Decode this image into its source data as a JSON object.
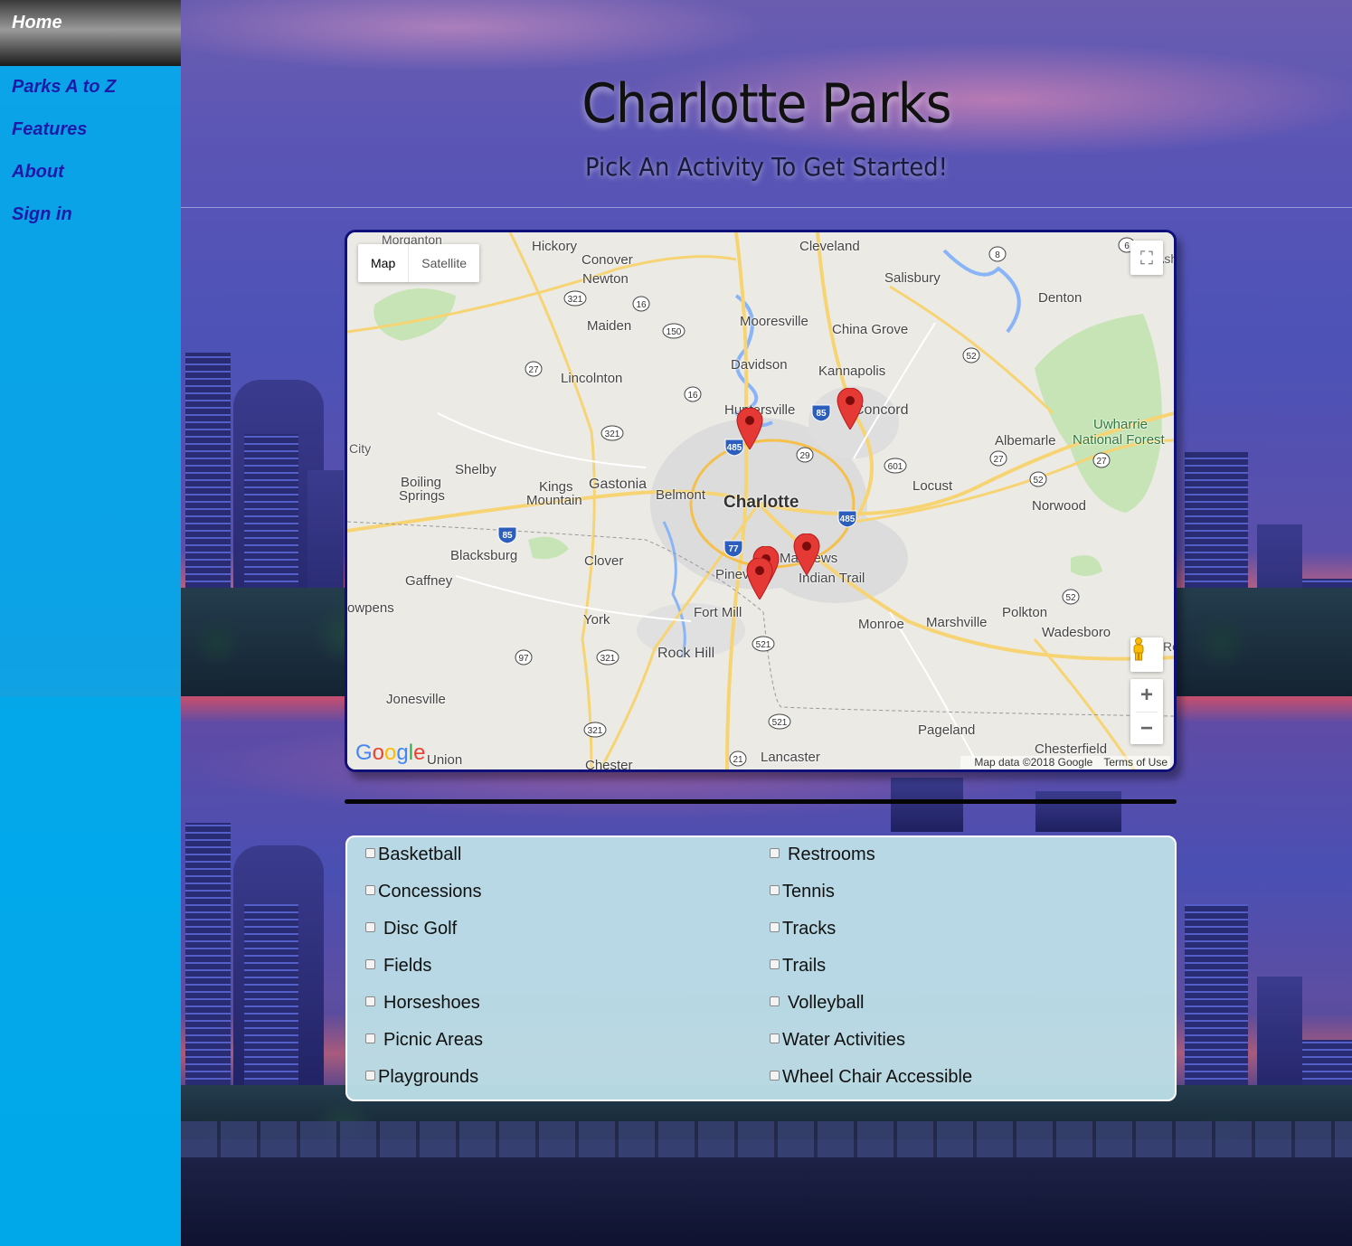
{
  "sidebar": {
    "items": [
      {
        "label": "Home"
      },
      {
        "label": "Parks A to Z"
      },
      {
        "label": "Features"
      },
      {
        "label": "About"
      },
      {
        "label": "Sign in"
      }
    ]
  },
  "header": {
    "title": "Charlotte Parks",
    "subtitle": "Pick An Activity To Get Started!"
  },
  "map": {
    "type_buttons": [
      "Map",
      "Satellite"
    ],
    "selected_type": "Map",
    "attribution": "Map data ©2018 Google",
    "terms": "Terms of Use",
    "logo": "Google",
    "labels": {
      "charlotte": "Charlotte",
      "gastonia": "Gastonia",
      "rock_hill": "Rock Hill",
      "concord": "Concord",
      "kannapolis": "Kannapolis",
      "hickory": "Hickory",
      "cleveland": "Cleveland",
      "salisbury": "Salisbury",
      "denton": "Denton",
      "morganton": "Morganton",
      "conover": "Conover",
      "newton": "Newton",
      "maiden": "Maiden",
      "mooresville": "Mooresville",
      "china_grove": "China Grove",
      "davidson": "Davidson",
      "lincolnton": "Lincolnton",
      "huntersville": "Huntersville",
      "albemarle": "Albemarle",
      "uwharrie": "Uwharrie",
      "national_forest": "National Forest",
      "city": "City",
      "shelby": "Shelby",
      "boiling": "Boiling",
      "springs": "Springs",
      "kings": "Kings",
      "mountain": "Mountain",
      "belmont": "Belmont",
      "locust": "Locust",
      "norwood": "Norwood",
      "blacksburg": "Blacksburg",
      "clover": "Clover",
      "matthews": "Matthews",
      "pineville": "Pineville",
      "indian_trail": "Indian Trail",
      "gaffney": "Gaffney",
      "cowpens": "owpens",
      "fort_mill": "Fort Mill",
      "york": "York",
      "monroe": "Monroe",
      "marshville": "Marshville",
      "polkton": "Polkton",
      "wadesboro": "Wadesboro",
      "jonesville": "Jonesville",
      "pageland": "Pageland",
      "chesterfield": "Chesterfield",
      "union": "Union",
      "chester": "Chester",
      "lancaster": "Lancaster",
      "ash": "Ash",
      "ro": "Ro"
    },
    "shields": [
      "321",
      "16",
      "150",
      "27",
      "16",
      "321",
      "485",
      "85",
      "29",
      "601",
      "52",
      "27",
      "27",
      "52",
      "8",
      "6",
      "485",
      "85",
      "77",
      "97",
      "321",
      "521",
      "521",
      "321",
      "21",
      "52"
    ]
  },
  "activities": {
    "left": [
      "Basketball",
      "Concessions",
      "Disc Golf",
      "Fields",
      "Horseshoes",
      "Picnic Areas",
      "Playgrounds"
    ],
    "right": [
      "Restrooms",
      "Tennis",
      "Tracks",
      "Trails",
      "Volleyball",
      "Water Activities",
      "Wheel Chair Accessible"
    ]
  },
  "colors": {
    "sidebar": "#00aeef",
    "nav_text": "#1d1aa8",
    "map_border": "#10107a",
    "panel": "#bbdee6",
    "marker": "#e53935"
  }
}
